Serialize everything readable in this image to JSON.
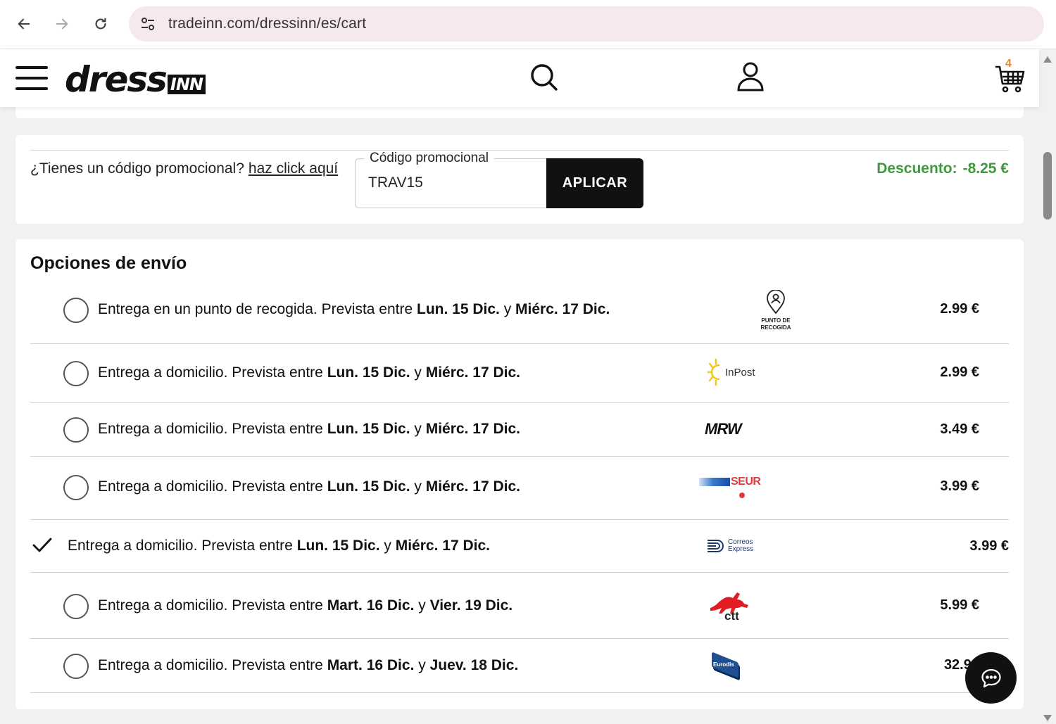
{
  "browser": {
    "url": "tradeinn.com/dressinn/es/cart"
  },
  "header": {
    "logo_main": "dress",
    "logo_box": "INN",
    "cart_count": "4"
  },
  "promo": {
    "question": "¿Tienes un código promocional?",
    "link": "haz click aquí",
    "field_label": "Código promocional",
    "field_value": "TRAV15",
    "apply_label": "APLICAR",
    "discount_label": "Descuento:",
    "discount_value": "-8.25 €"
  },
  "shipping": {
    "title": "Opciones de envío",
    "text_prefix": "Prevista entre",
    "conj": "y",
    "options": [
      {
        "type": "Entrega en un punto de recogida.",
        "from": "Lun. 15 Dic.",
        "to": "Miérc. 17 Dic.",
        "carrier": "PUNTO DE RECOGIDA",
        "carrier_icon": "pickup-point-icon",
        "price": "2.99 €",
        "selected": false
      },
      {
        "type": "Entrega a domicilio.",
        "from": "Lun. 15 Dic.",
        "to": "Miérc. 17 Dic.",
        "carrier": "InPost",
        "carrier_icon": "inpost-logo",
        "price": "2.99 €",
        "selected": false
      },
      {
        "type": "Entrega a domicilio.",
        "from": "Lun. 15 Dic.",
        "to": "Miérc. 17 Dic.",
        "carrier": "MRW",
        "carrier_icon": "mrw-logo",
        "price": "3.49 €",
        "selected": false
      },
      {
        "type": "Entrega a domicilio.",
        "from": "Lun. 15 Dic.",
        "to": "Miérc. 17 Dic.",
        "carrier": "SEUR",
        "carrier_icon": "seur-logo",
        "price": "3.99 €",
        "selected": false
      },
      {
        "type": "Entrega a domicilio.",
        "from": "Lun. 15 Dic.",
        "to": "Miérc. 17 Dic.",
        "carrier": "Correos Express",
        "carrier_icon": "correos-express-logo",
        "price": "3.99 €",
        "selected": true
      },
      {
        "type": "Entrega a domicilio.",
        "from": "Mart. 16 Dic.",
        "to": "Vier. 19 Dic.",
        "carrier": "ctt",
        "carrier_icon": "ctt-logo",
        "price": "5.99 €",
        "selected": false
      },
      {
        "type": "Entrega a domicilio.",
        "from": "Mart. 16 Dic.",
        "to": "Juev. 18 Dic.",
        "carrier": "Eurodis",
        "carrier_icon": "eurodis-logo",
        "price": "32.99",
        "selected": false
      }
    ]
  },
  "colors": {
    "discount": "#3f9a3f",
    "button": "#111111",
    "cart_badge": "#e8892e",
    "urlbar": "#f6e8ef"
  }
}
